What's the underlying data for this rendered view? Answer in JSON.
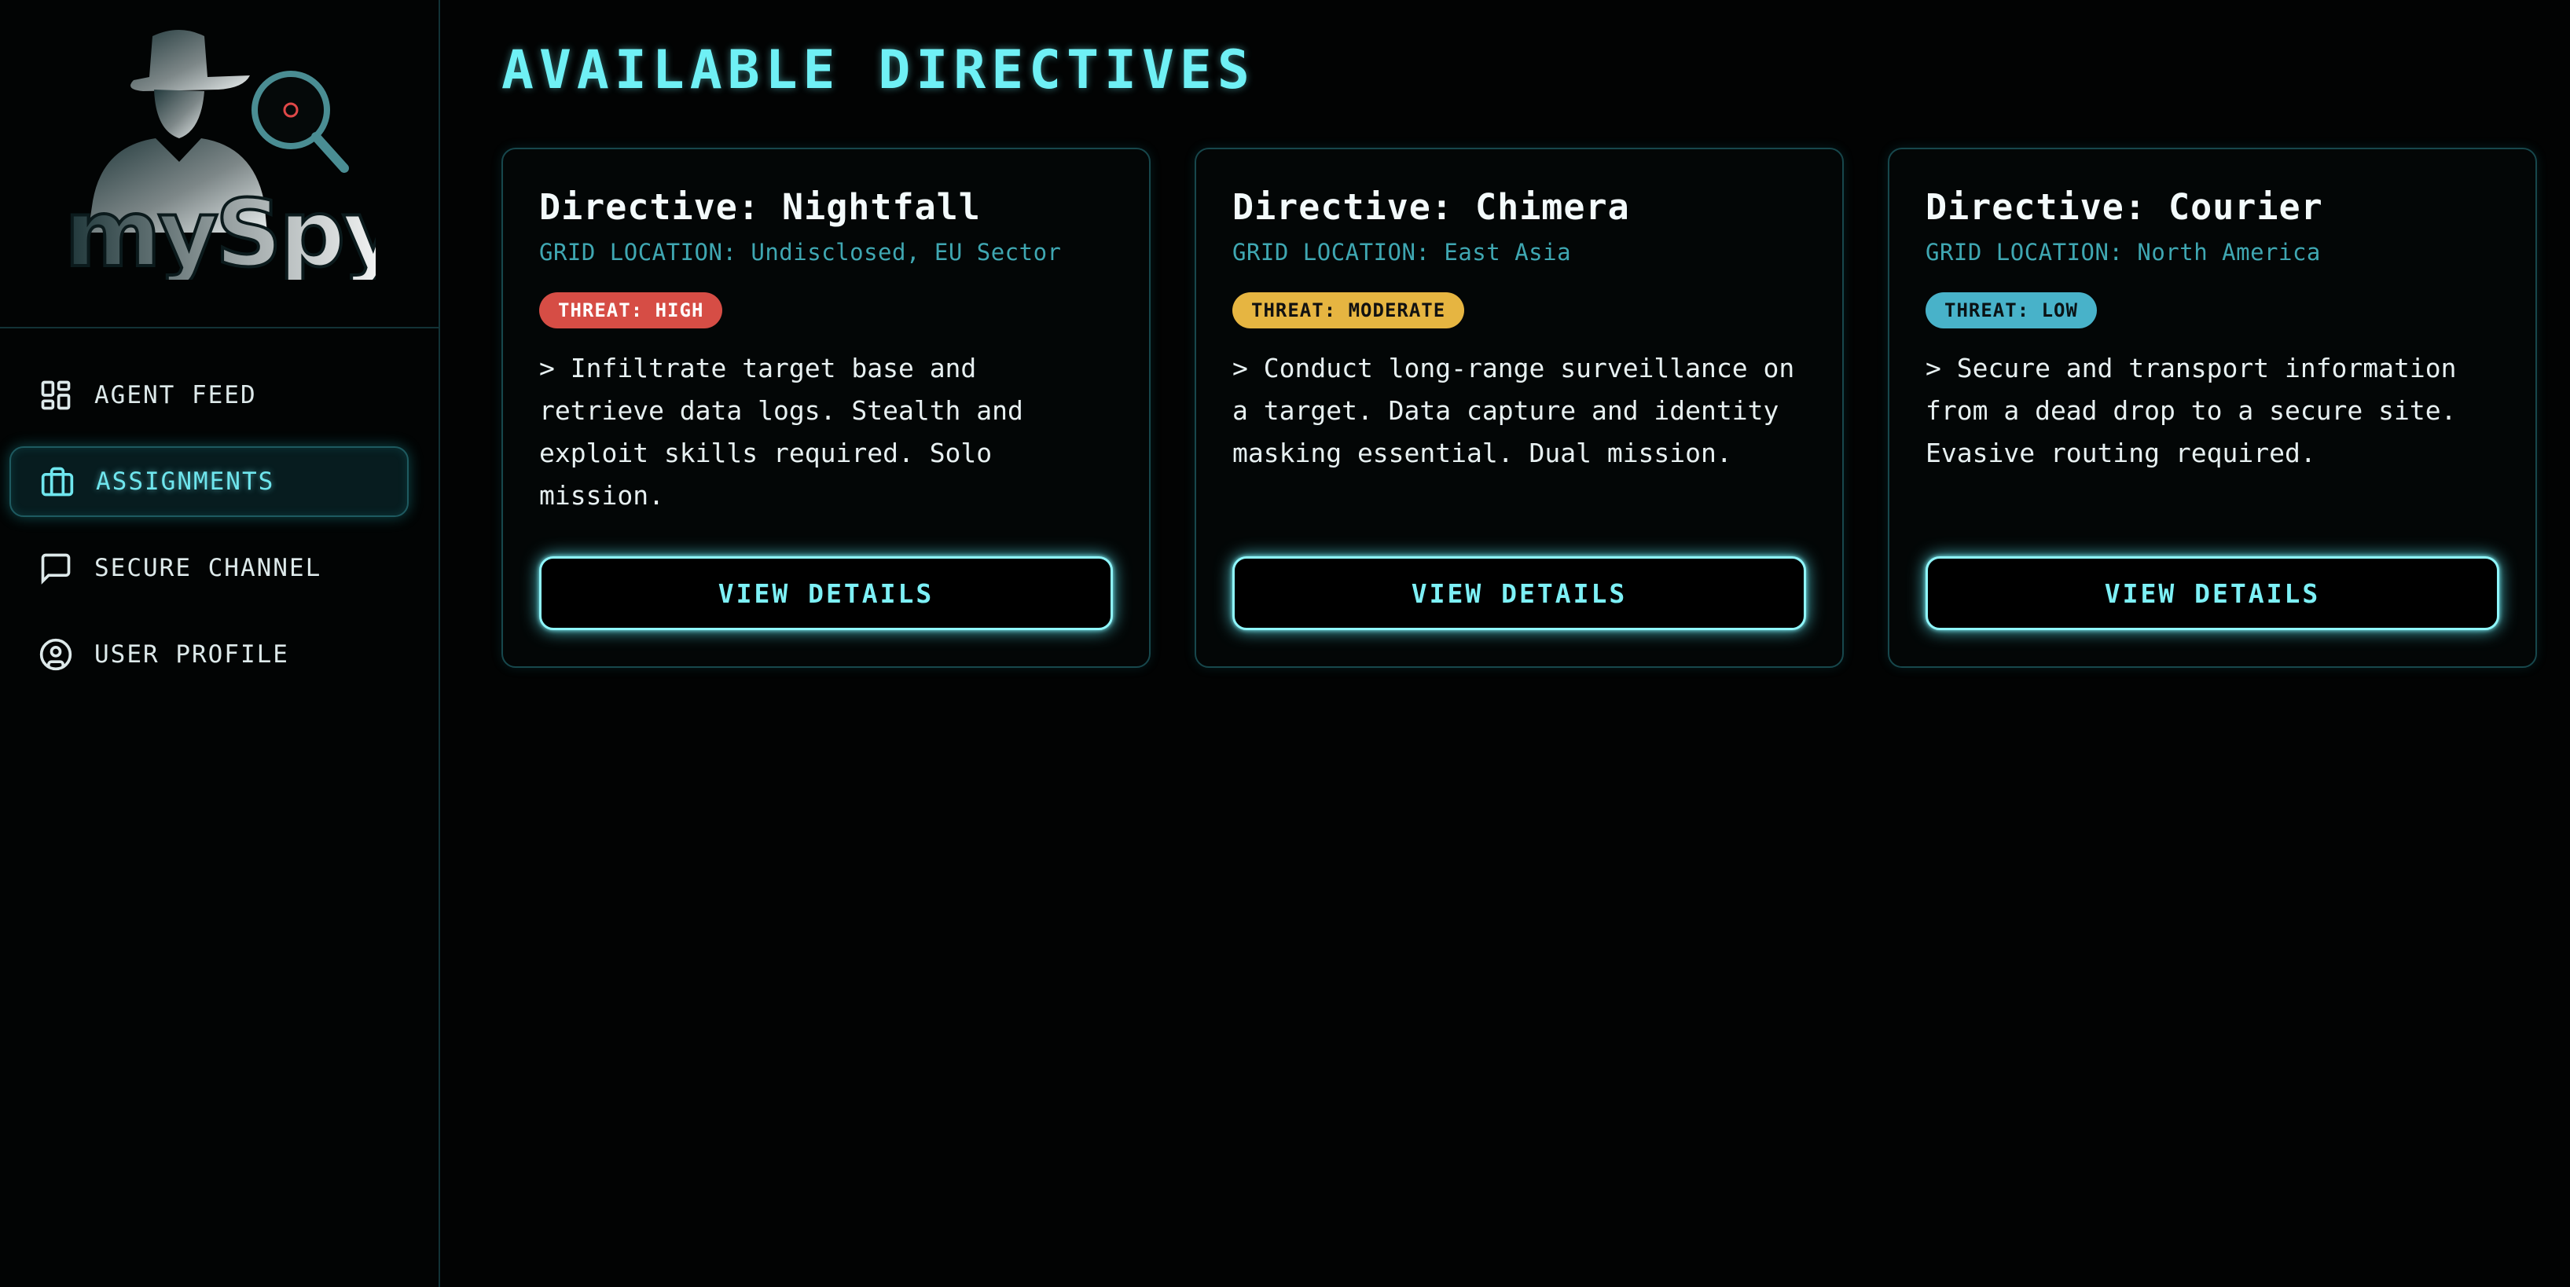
{
  "logo": {
    "text": "mySpy",
    "icon": "spy-magnifier-logo"
  },
  "sidebar": {
    "items": [
      {
        "label": "AGENT FEED",
        "icon": "dashboard-grid-icon",
        "active": false
      },
      {
        "label": "ASSIGNMENTS",
        "icon": "briefcase-icon",
        "active": true
      },
      {
        "label": "SECURE CHANNEL",
        "icon": "chat-bubble-icon",
        "active": false
      },
      {
        "label": "USER PROFILE",
        "icon": "user-circle-icon",
        "active": false
      }
    ]
  },
  "main": {
    "title": "AVAILABLE DIRECTIVES",
    "cards": [
      {
        "title": "Directive: Nightfall",
        "location": "GRID LOCATION: Undisclosed, EU Sector",
        "threat": "THREAT: HIGH",
        "threat_level": "high",
        "description": "> Infiltrate target base and retrieve data logs. Stealth and exploit skills required. Solo mission.",
        "button": "VIEW DETAILS"
      },
      {
        "title": "Directive: Chimera",
        "location": "GRID LOCATION: East Asia",
        "threat": "THREAT: MODERATE",
        "threat_level": "moderate",
        "description": "> Conduct long-range surveillance on a target. Data capture and identity masking essential. Dual mission.",
        "button": "VIEW DETAILS"
      },
      {
        "title": "Directive: Courier",
        "location": "GRID LOCATION: North America",
        "threat": "THREAT: LOW",
        "threat_level": "low",
        "description": "> Secure and transport information from a dead drop to a secure site. Evasive routing required.",
        "button": "VIEW DETAILS"
      }
    ]
  },
  "colors": {
    "accent": "#6ff0f5",
    "threat_high": "#d64d45",
    "threat_moderate": "#e6b541",
    "threat_low": "#48b2c9"
  }
}
